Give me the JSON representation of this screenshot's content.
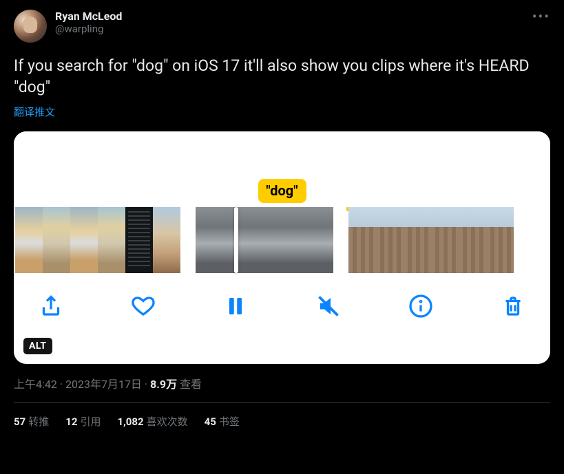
{
  "author": {
    "display_name": "Ryan McLeod",
    "handle": "@warpling"
  },
  "tweet_text": "If you search for \"dog\" on iOS 17 it'll also show you clips where it's HEARD \"dog\"",
  "translate_label": "翻译推文",
  "media": {
    "search_term_label": "\"dog\"",
    "alt_badge": "ALT"
  },
  "meta": {
    "time": "上午4:42",
    "separator": " · ",
    "date": "2023年7月17日",
    "views_number": "8.9万",
    "views_label": " 查看"
  },
  "stats": {
    "retweets": {
      "count": "57",
      "label": "转推"
    },
    "quotes": {
      "count": "12",
      "label": "引用"
    },
    "likes": {
      "count": "1,082",
      "label": "喜欢次数"
    },
    "bookmarks": {
      "count": "45",
      "label": "书签"
    }
  }
}
